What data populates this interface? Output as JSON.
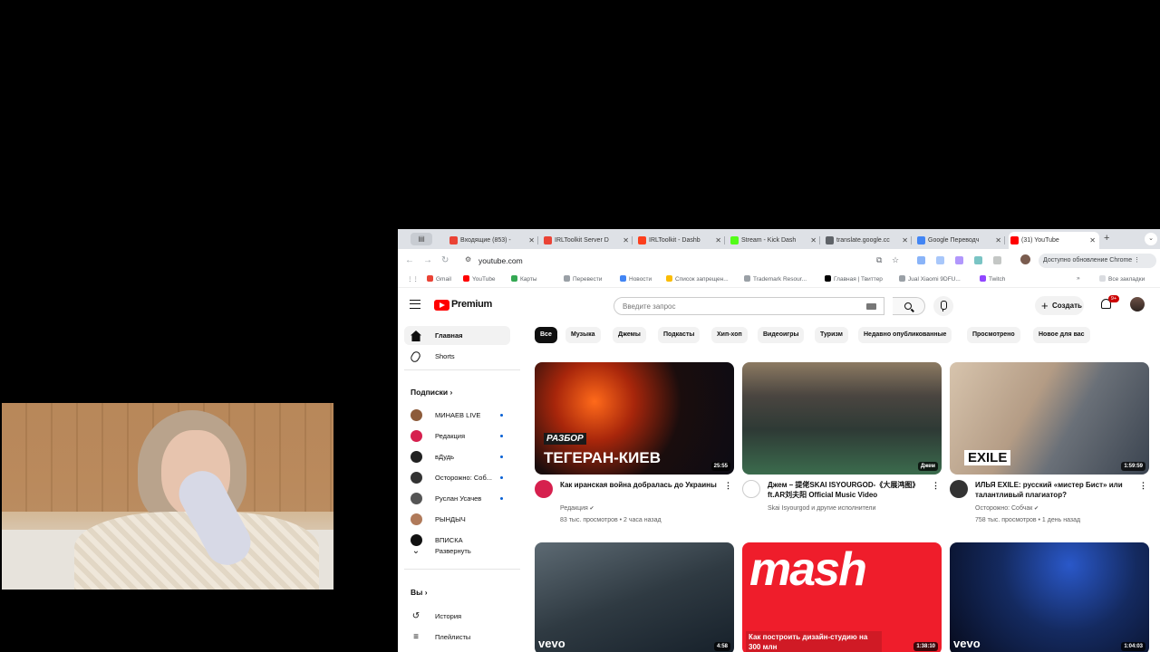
{
  "browser": {
    "tabs": [
      {
        "label": "Входящие (853) -",
        "icon": "gmail-icon",
        "color": "#ea4335"
      },
      {
        "label": "IRLToolkit Server D",
        "icon": "gmail-icon",
        "color": "#ea4335"
      },
      {
        "label": "IRLToolkit - Dashb",
        "icon": "yandex-icon",
        "color": "#fc3f1d"
      },
      {
        "label": "Stream - Kick Dash",
        "icon": "kick-icon",
        "color": "#53fc18"
      },
      {
        "label": "translate.google.cc",
        "icon": "globe-icon",
        "color": "#5f6368"
      },
      {
        "label": "Google Переводч",
        "icon": "translate-icon",
        "color": "#4285f4"
      },
      {
        "label": "(31) YouTube",
        "icon": "youtube-icon",
        "color": "#ff0000"
      }
    ],
    "url": "youtube.com",
    "update_label": "Доступно обновление Chrome",
    "bookmarks": [
      {
        "label": "Gmail",
        "color": "#ea4335"
      },
      {
        "label": "YouTube",
        "color": "#ff0000"
      },
      {
        "label": "Карты",
        "color": "#34a853"
      },
      {
        "label": "Перевести",
        "color": "#9aa0a6"
      },
      {
        "label": "Новости",
        "color": "#4285f4"
      },
      {
        "label": "Список запрещен...",
        "color": "#fbbc04"
      },
      {
        "label": "Trademark Resour...",
        "color": "#9aa0a6"
      },
      {
        "label": "Главная | Твиттер",
        "color": "#000000"
      },
      {
        "label": "Jual Xiaomi 9DFU...",
        "color": "#9aa0a6"
      },
      {
        "label": "Twitch",
        "color": "#9146ff"
      }
    ],
    "all_bookmarks_label": "Все закладки"
  },
  "youtube": {
    "logo_text": "Premium",
    "search_placeholder": "Введите запрос",
    "create_label": "Создать",
    "notification_count": "9+",
    "sidebar": {
      "main": [
        {
          "label": "Главная",
          "icon": "home-icon",
          "active": true
        },
        {
          "label": "Shorts",
          "icon": "shorts-icon",
          "active": false
        }
      ],
      "subscriptions_title": "Подписки",
      "subscriptions": [
        {
          "label": "МИНАЕВ LIVE",
          "color": "#8d5b3a",
          "new": true
        },
        {
          "label": "Редакция",
          "color": "#d6204e",
          "new": true
        },
        {
          "label": "вДудь",
          "color": "#222222",
          "new": true
        },
        {
          "label": "Осторожно: Соб...",
          "color": "#333333",
          "new": true
        },
        {
          "label": "Руслан Усачев",
          "color": "#555555",
          "new": true
        },
        {
          "label": "РЫНДЫЧ",
          "color": "#b07a5a",
          "new": false
        },
        {
          "label": "ВПИСКА",
          "color": "#111111",
          "new": false
        }
      ],
      "expand_label": "Развернуть",
      "you_title": "Вы",
      "you_items": [
        {
          "label": "История",
          "icon": "history-icon"
        },
        {
          "label": "Плейлисты",
          "icon": "playlists-icon"
        }
      ]
    },
    "chips": [
      "Все",
      "Музыка",
      "Джемы",
      "Подкасты",
      "Хип-хоп",
      "Видеоигры",
      "Туризм",
      "Недавно опубликованные",
      "Просмотрено",
      "Новое для вас"
    ],
    "videos": [
      {
        "title": "Как иранская война добралась до Украины",
        "channel": "Редакция",
        "verified": true,
        "meta": "83 тыс. просмотров • 2 часа назад",
        "duration": "25:55",
        "overlay": "ТЕГЕРАН-КИЕВ",
        "overlay2": "РАЗБОР",
        "avatar_color": "#d6204e"
      },
      {
        "title": "Джем – 提佬SKAI ISYOURGOD-《大展鸿图》ft.AR刘夫阳 Official Music Video",
        "channel": "Skai Isyourgod и другие исполнители",
        "verified": false,
        "meta": "",
        "duration": "Джем",
        "overlay": "",
        "overlay2": "",
        "avatar_color": "#ffffff"
      },
      {
        "title": "ИЛЬЯ EXILE: русский «мистер Бист» или талантливый плагиатор?",
        "channel": "Осторожно: Собчак",
        "verified": true,
        "meta": "758 тыс. просмотров • 1 день назад",
        "duration": "1:59:59",
        "overlay": "EXILE",
        "overlay2": "",
        "avatar_color": "#333333"
      },
      {
        "title": "",
        "channel": "",
        "verified": false,
        "meta": "",
        "duration": "4:58",
        "overlay": "vevo",
        "overlay2": "",
        "avatar_color": "#000000"
      },
      {
        "title": "",
        "channel": "",
        "verified": false,
        "meta": "",
        "duration": "1:38:10",
        "overlay": "Как построить дизайн-студию на 300 млн",
        "overlay2": "mash",
        "avatar_color": "#000000"
      },
      {
        "title": "",
        "channel": "",
        "verified": false,
        "meta": "",
        "duration": "1:04:03",
        "overlay": "vevo",
        "overlay2": "",
        "avatar_color": "#000000"
      }
    ]
  }
}
